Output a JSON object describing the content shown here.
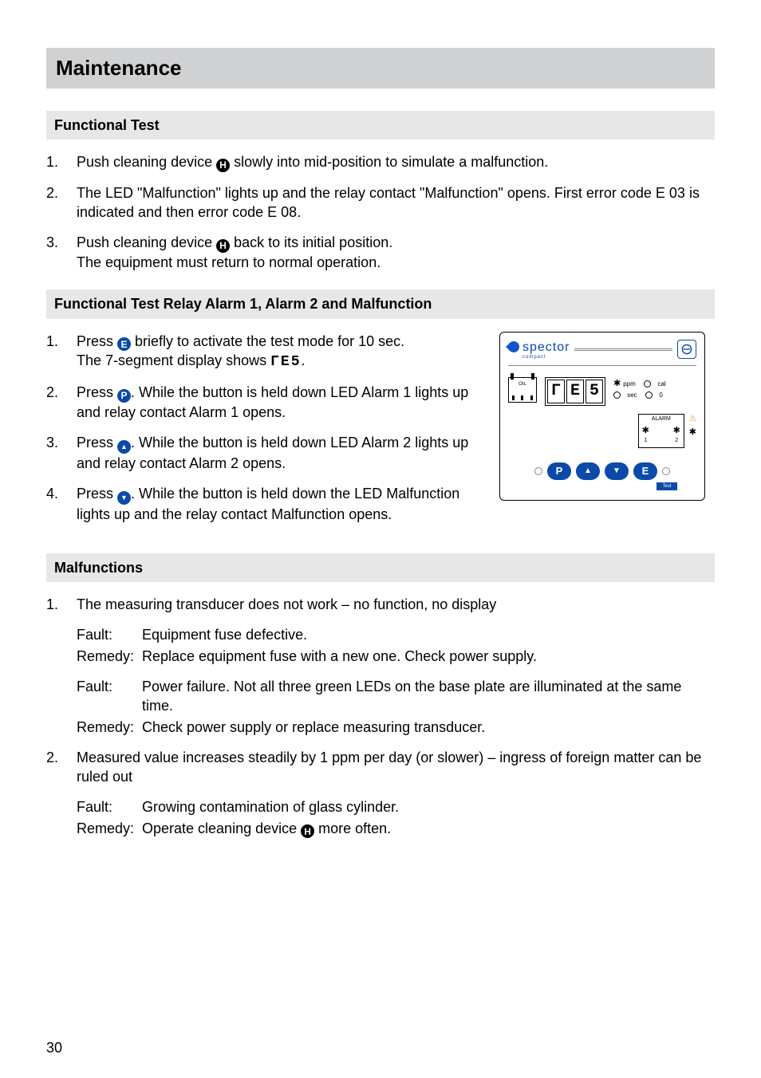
{
  "page_number": "30",
  "heading": "Maintenance",
  "sections": {
    "s1": {
      "title": "Functional Test",
      "steps": [
        {
          "n": "1.",
          "pre": "Push cleaning device ",
          "icon": "H",
          "post": " slowly into mid-position to simulate a malfunction."
        },
        {
          "n": "2.",
          "text": "The LED \"Malfunction\" lights up and the relay contact \"Malfunction\" opens. First error code E 03 is indicated and then error code E 08."
        },
        {
          "n": "3.",
          "pre": "Push cleaning device ",
          "icon": "H",
          "post": " back to its initial position.",
          "line2": "The equipment must return to normal operation."
        }
      ]
    },
    "s2": {
      "title": "Functional Test Relay Alarm 1, Alarm 2 and Malfunction",
      "steps": [
        {
          "n": "1.",
          "pre": "Press ",
          "icon": "E",
          "post": " briefly to activate the test mode for 10 sec.",
          "line2pre": "The 7-segment display shows ",
          "seg": "ΓE5",
          "line2post": "."
        },
        {
          "n": "2.",
          "pre": "Press ",
          "icon": "P",
          "post": ". While the button is held down LED Alarm 1 lights up and relay contact Alarm 1 opens."
        },
        {
          "n": "3.",
          "pre": "Press ",
          "icon": "up",
          "post": ". While the button is held down LED Alarm 2 lights up and relay contact Alarm 2 opens."
        },
        {
          "n": "4.",
          "pre": "Press ",
          "icon": "down",
          "post": ". While the button is held down the LED Malfunction lights up and the relay contact Malfunction opens."
        }
      ]
    },
    "s3": {
      "title": "Malfunctions",
      "items": [
        {
          "n": "1.",
          "head": "The measuring transducer does not work – no function, no display",
          "pairs": [
            {
              "fault": "Equipment fuse defective.",
              "remedy": "Replace equipment fuse with a new one. Check power supply."
            },
            {
              "fault": "Power failure. Not all three green LEDs on the base plate are illuminated at the same time.",
              "remedy": "Check power supply or replace measuring transducer."
            }
          ]
        },
        {
          "n": "2.",
          "head": "Measured value increases steadily by 1 ppm per day (or slower) – ingress of foreign matter can be ruled out",
          "pairs": [
            {
              "fault": "Growing contamination of glass cylinder.",
              "remedyPre": "Operate cleaning device ",
              "remedyIcon": "H",
              "remedyPost": " more often."
            }
          ]
        }
      ]
    }
  },
  "labels": {
    "fault": "Fault:",
    "remedy": "Remedy:"
  },
  "device": {
    "logo": "spector",
    "logo_sub": "compact",
    "oil": "OIL",
    "seg": [
      "Γ",
      "E",
      "5"
    ],
    "ppm": "ppm",
    "cal": "cal",
    "sec": "sec",
    "zero": "0",
    "alarm": "ALARM",
    "a1": "1",
    "a2": "2",
    "btn_p": "P",
    "btn_e": "E",
    "test": "Test"
  }
}
